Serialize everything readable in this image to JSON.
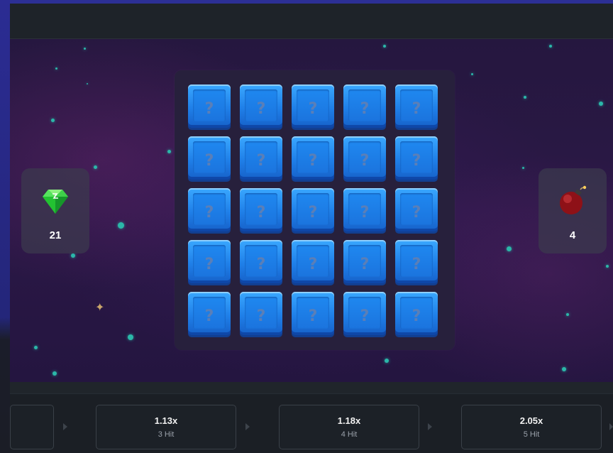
{
  "counters": {
    "gems": {
      "icon": "green-gem-icon",
      "value": "21"
    },
    "mines": {
      "icon": "bomb-icon",
      "value": "4"
    }
  },
  "board": {
    "rows": 5,
    "cols": 5,
    "tile_symbol": "?",
    "tile_color": "#2a8ef5"
  },
  "multipliers": [
    {
      "value": "",
      "hits": ""
    },
    {
      "value": "1.13x",
      "hits": "3 Hit"
    },
    {
      "value": "1.18x",
      "hits": "4 Hit"
    },
    {
      "value": "2.05x",
      "hits": "5 Hit"
    }
  ],
  "colors": {
    "accent_blue": "#2a8ef5",
    "gem_green": "#2fd13a",
    "bomb_red": "#a0161c",
    "star_teal": "#2bb7a9"
  }
}
